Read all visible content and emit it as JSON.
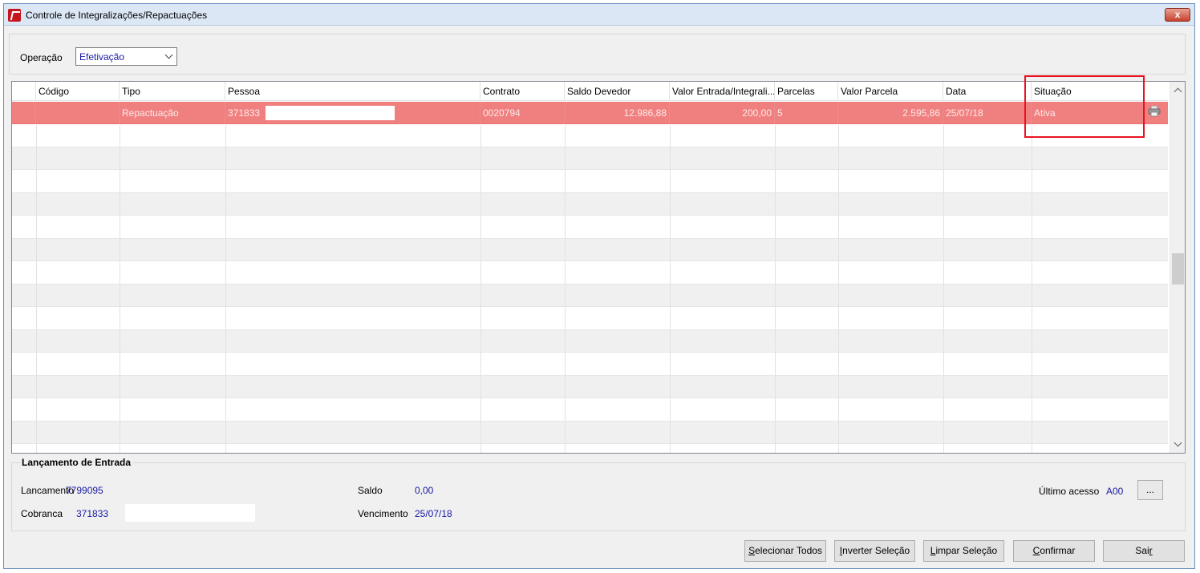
{
  "window": {
    "title": "Controle de Integralizações/Repactuações",
    "close_label": "x"
  },
  "operacao": {
    "label": "Operação",
    "selected": "Efetivação"
  },
  "grid": {
    "columns": [
      "",
      "Código",
      "Tipo",
      "Pessoa",
      "Contrato",
      "Saldo Devedor",
      "Valor Entrada/Integrali...",
      "Parcelas",
      "Valor Parcela",
      "Data",
      "Situação"
    ],
    "rows": [
      {
        "selected": true,
        "codigo": "",
        "tipo": "Repactuação",
        "pessoa": "371833",
        "contrato": "0020794",
        "saldo_devedor": "12.986,88",
        "valor_entrada": "200,00",
        "parcelas": "5",
        "valor_parcela": "2.595,86",
        "data": "25/07/18",
        "situacao": "Ativa"
      }
    ]
  },
  "entrada": {
    "legend": "Lançamento de Entrada",
    "lancamento_label": "Lancamento",
    "lancamento_value": "7799095",
    "cobranca_label": "Cobranca",
    "cobranca_value": "371833",
    "saldo_label": "Saldo",
    "saldo_value": "0,00",
    "vencimento_label": "Vencimento",
    "vencimento_value": "25/07/18",
    "ultimo_acesso_label": "Último acesso",
    "ultimo_acesso_value": "A00",
    "ellipsis_label": "..."
  },
  "buttons": {
    "selecionar_todos": {
      "first": "S",
      "rest": "elecionar Todos"
    },
    "inverter_selecao": {
      "first": "I",
      "rest": "nverter Seleção"
    },
    "limpar_selecao": {
      "first": "L",
      "rest": "impar Seleção"
    },
    "confirmar": {
      "first": "C",
      "rest": "onfirmar"
    },
    "sair": {
      "first": "Sai",
      "rest": "r"
    }
  },
  "colors": {
    "selected_row": "#f08080",
    "highlight": "#e8121f",
    "value_text": "#1a1aa6"
  }
}
